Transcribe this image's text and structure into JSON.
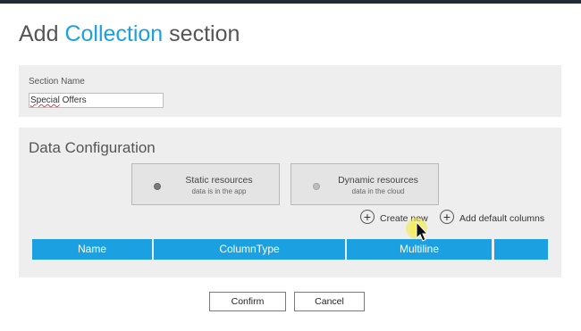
{
  "dialog": {
    "title_prefix": "Add ",
    "title_accent": "Collection",
    "title_suffix": " section"
  },
  "section_name": {
    "label": "Section Name",
    "value_word1": "Special",
    "value_rest": " Offers"
  },
  "data_configuration": {
    "title": "Data Configuration",
    "options": [
      {
        "title": "Static resources",
        "subtitle": "data is in the app",
        "selected": true
      },
      {
        "title": "Dynamic resources",
        "subtitle": "data in the cloud",
        "selected": false
      }
    ],
    "actions": {
      "create_new": "Create new",
      "add_default_columns": "Add default columns"
    },
    "columns": [
      "Name",
      "ColumnType",
      "Multiline",
      ""
    ]
  },
  "footer": {
    "confirm": "Confirm",
    "cancel": "Cancel"
  },
  "colors": {
    "accent": "#1ba1e2",
    "panel": "#eeeeee",
    "topbar": "#1e2a36"
  }
}
